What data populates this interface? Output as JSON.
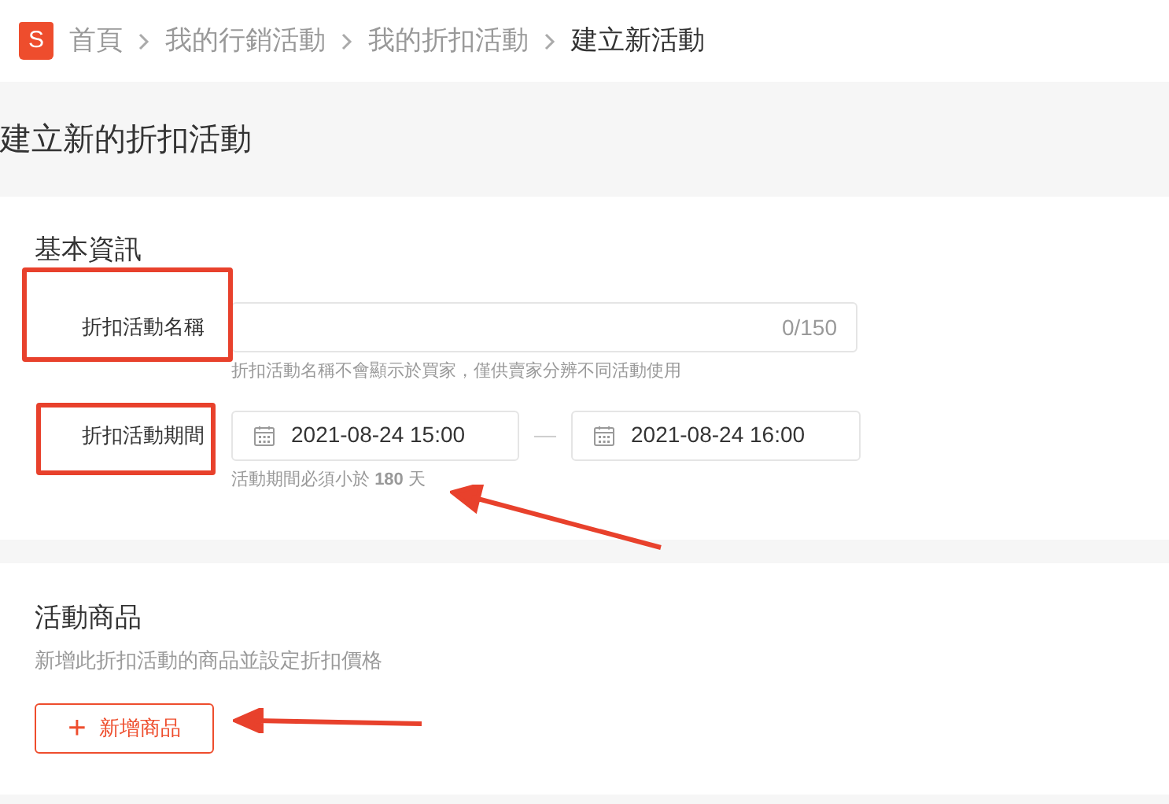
{
  "logo_letter": "S",
  "breadcrumb": [
    {
      "label": "首頁",
      "current": false
    },
    {
      "label": "我的行銷活動",
      "current": false
    },
    {
      "label": "我的折扣活動",
      "current": false
    },
    {
      "label": "建立新活動",
      "current": true
    }
  ],
  "page_title": "建立新的折扣活動",
  "basic_info": {
    "title": "基本資訊",
    "name_field": {
      "label": "折扣活動名稱",
      "counter": "0/150",
      "help": "折扣活動名稱不會顯示於買家，僅供賣家分辨不同活動使用"
    },
    "period": {
      "label": "折扣活動期間",
      "start": "2021-08-24 15:00",
      "separator": "—",
      "end": "2021-08-24 16:00",
      "hint": "活動期間必須小於 **180** 天"
    }
  },
  "products": {
    "title": "活動商品",
    "subtitle": "新增此折扣活動的商品並設定折扣價格",
    "add_button": {
      "icon": "+",
      "label": "新增商品"
    }
  }
}
